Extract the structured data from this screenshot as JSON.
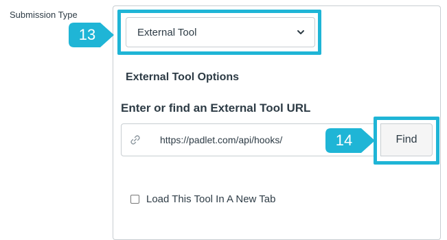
{
  "form": {
    "submission_type_label": "Submission Type",
    "submission_type_value": "External Tool",
    "options_title": "External Tool Options",
    "url_label": "Enter or find an External Tool URL",
    "url_value": "https://padlet.com/api/hooks/",
    "find_button": "Find",
    "new_tab_checkbox_label": "Load This Tool In A New Tab",
    "new_tab_checked": false
  },
  "callouts": {
    "step_select": "13",
    "step_find": "14"
  },
  "colors": {
    "highlight": "#1fb5d6",
    "text": "#2d3b45",
    "border": "#c7cdd1"
  },
  "icons": {
    "chevron": "chevron-down-icon",
    "link": "link-icon"
  }
}
